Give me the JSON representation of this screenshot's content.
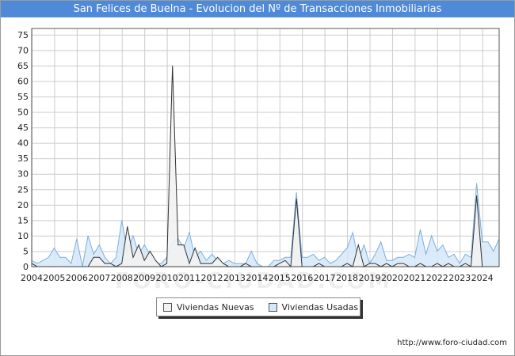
{
  "header": {
    "title": "San Felices de Buelna - Evolucion del Nº de Transacciones Inmobiliarias"
  },
  "footer": {
    "url": "http://www.foro-ciudad.com"
  },
  "watermark": "FORO-CIUDAD.COM",
  "colors": {
    "title_bg": "#4f8ad8",
    "nuevas_fill": "#f2f2f2",
    "nuevas_line": "#333333",
    "usadas_fill": "#d6e8f8",
    "usadas_line": "#7aaee0",
    "grid": "#cccccc"
  },
  "chart_data": {
    "type": "area",
    "title": "San Felices de Buelna - Evolucion del Nº de Transacciones Inmobiliarias",
    "xlabel": "",
    "ylabel": "",
    "ylim": [
      0,
      77
    ],
    "yticks": [
      0,
      5,
      10,
      15,
      20,
      25,
      30,
      35,
      40,
      45,
      50,
      55,
      60,
      65,
      70,
      75
    ],
    "xlim": [
      2004,
      2024.75
    ],
    "x_tick_labels": [
      "2004",
      "2005",
      "2006",
      "2007",
      "2008",
      "2009",
      "2010",
      "2011",
      "2012",
      "2013",
      "2014",
      "2015",
      "2016",
      "2017",
      "2018",
      "2019",
      "2020",
      "2021",
      "2022",
      "2023",
      "2024"
    ],
    "x": [
      2004.0,
      2004.25,
      2004.5,
      2004.75,
      2005.0,
      2005.25,
      2005.5,
      2005.75,
      2006.0,
      2006.25,
      2006.5,
      2006.75,
      2007.0,
      2007.25,
      2007.5,
      2007.75,
      2008.0,
      2008.25,
      2008.5,
      2008.75,
      2009.0,
      2009.25,
      2009.5,
      2009.75,
      2010.0,
      2010.25,
      2010.5,
      2010.75,
      2011.0,
      2011.25,
      2011.5,
      2011.75,
      2012.0,
      2012.25,
      2012.5,
      2012.75,
      2013.0,
      2013.25,
      2013.5,
      2013.75,
      2014.0,
      2014.25,
      2014.5,
      2014.75,
      2015.0,
      2015.25,
      2015.5,
      2015.75,
      2016.0,
      2016.25,
      2016.5,
      2016.75,
      2017.0,
      2017.25,
      2017.5,
      2017.75,
      2018.0,
      2018.25,
      2018.5,
      2018.75,
      2019.0,
      2019.25,
      2019.5,
      2019.75,
      2020.0,
      2020.25,
      2020.5,
      2020.75,
      2021.0,
      2021.25,
      2021.5,
      2021.75,
      2022.0,
      2022.25,
      2022.5,
      2022.75,
      2023.0,
      2023.25,
      2023.5,
      2023.75,
      2024.0,
      2024.25,
      2024.5,
      2024.75
    ],
    "series": [
      {
        "name": "Viviendas Nuevas",
        "values": [
          1,
          0,
          0,
          0,
          0,
          0,
          0,
          0,
          0,
          0,
          0,
          3,
          3,
          1,
          1,
          0,
          1,
          13,
          3,
          7,
          2,
          5,
          2,
          0,
          1,
          65,
          7,
          7,
          1,
          6,
          1,
          1,
          1,
          3,
          1,
          0,
          0,
          0,
          1,
          0,
          0,
          0,
          0,
          0,
          1,
          2,
          0,
          22,
          0,
          0,
          0,
          1,
          0,
          0,
          0,
          0,
          1,
          0,
          7,
          0,
          1,
          1,
          0,
          1,
          0,
          1,
          1,
          0,
          0,
          1,
          0,
          0,
          1,
          0,
          1,
          0,
          0,
          1,
          0,
          23,
          0,
          0,
          0,
          0
        ]
      },
      {
        "name": "Viviendas Usadas",
        "values": [
          2,
          1,
          2,
          3,
          6,
          3,
          3,
          1,
          9,
          0,
          10,
          4,
          7,
          3,
          1,
          3,
          15,
          5,
          10,
          4,
          7,
          4,
          1,
          1,
          3,
          8,
          9,
          6,
          11,
          3,
          5,
          2,
          4,
          2,
          1,
          2,
          1,
          1,
          1,
          5,
          1,
          0,
          0,
          2,
          2,
          3,
          3,
          24,
          3,
          3,
          4,
          2,
          3,
          1,
          2,
          4,
          6,
          11,
          2,
          7,
          1,
          4,
          8,
          2,
          2,
          3,
          3,
          4,
          3,
          12,
          4,
          10,
          5,
          7,
          3,
          4,
          1,
          4,
          3,
          27,
          8,
          8,
          5,
          9
        ]
      }
    ]
  }
}
